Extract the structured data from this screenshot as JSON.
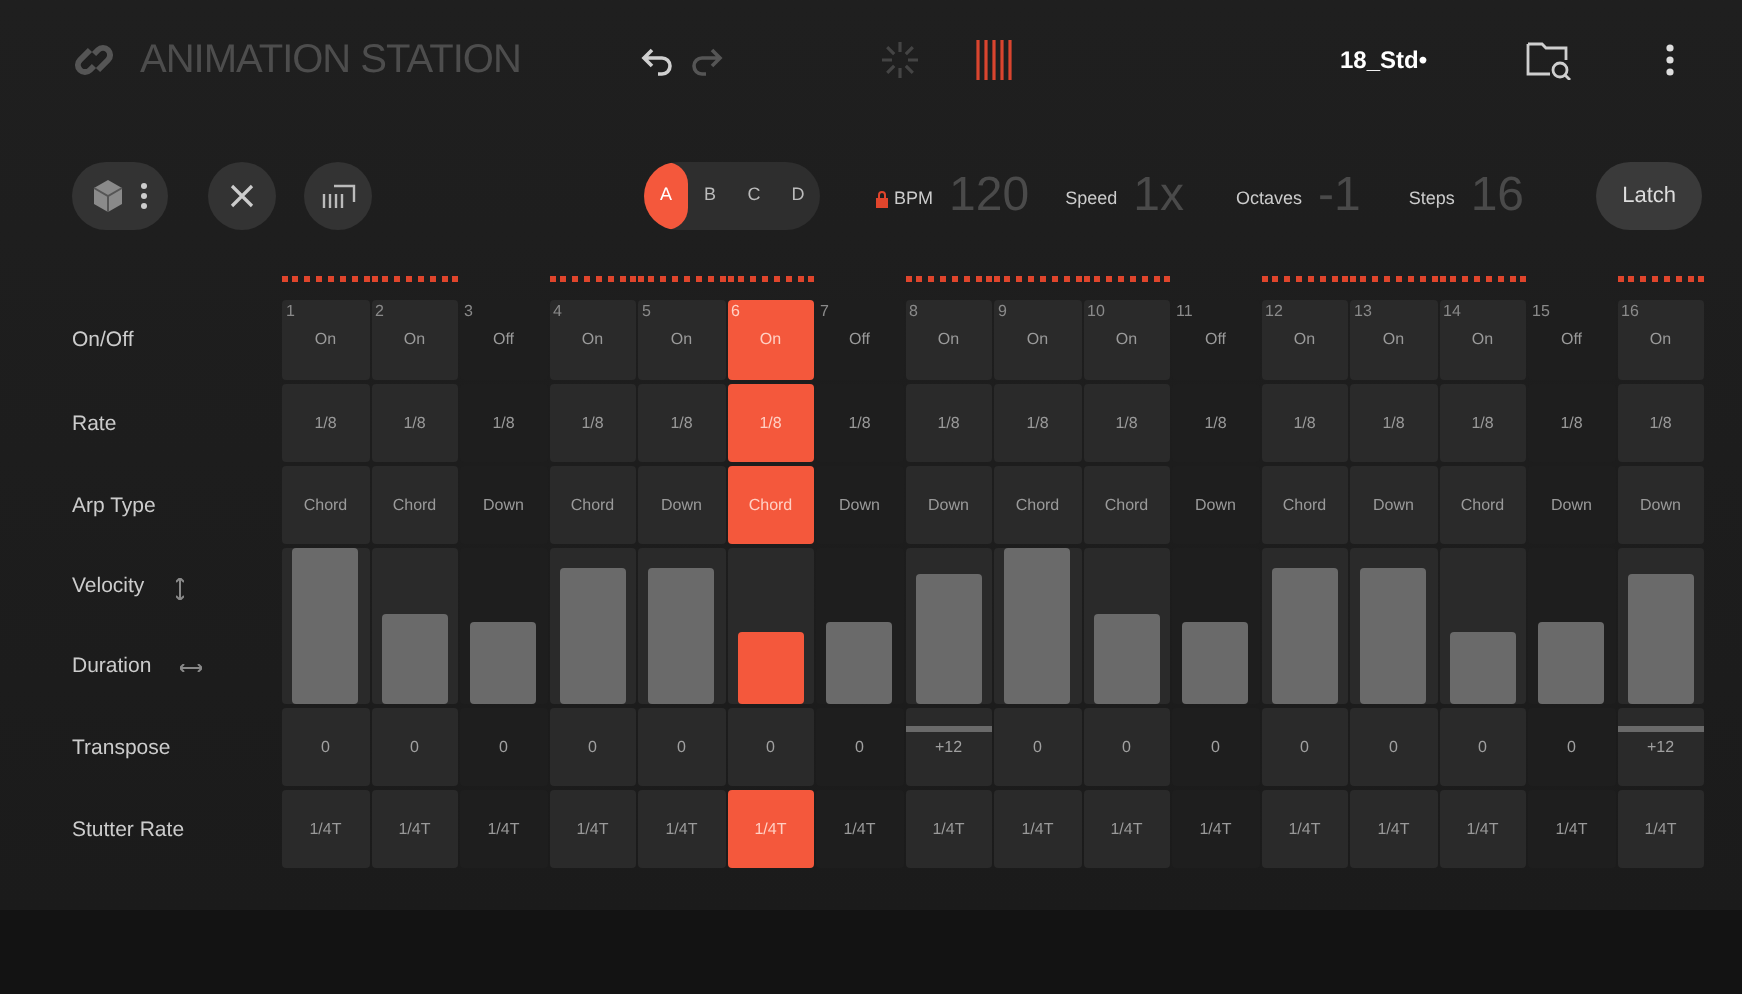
{
  "header": {
    "app_title": "ANIMATION STATION",
    "preset": "18_Std•"
  },
  "toolbar": {
    "patterns": [
      {
        "label": "A",
        "selected": true
      },
      {
        "label": "B",
        "selected": false
      },
      {
        "label": "C",
        "selected": false
      },
      {
        "label": "D",
        "selected": false
      }
    ],
    "params": [
      {
        "label": "BPM",
        "value": "120",
        "locked": true
      },
      {
        "label": "Speed",
        "value": "1x",
        "locked": false
      },
      {
        "label": "Octaves",
        "value": "-1",
        "locked": false
      },
      {
        "label": "Steps",
        "value": "16",
        "locked": false
      }
    ],
    "latch": "Latch"
  },
  "row_labels": [
    "On/Off",
    "Rate",
    "Arp Type",
    "Velocity",
    "Duration",
    "Transpose",
    "Stutter Rate"
  ],
  "steps": [
    {
      "number": "1",
      "on": true,
      "selected": false,
      "state": "On",
      "rate": "1/8",
      "arp": "Chord",
      "level": 1.0,
      "transpose": "0",
      "transpose_bar": false,
      "stutter": "1/4T"
    },
    {
      "number": "2",
      "on": true,
      "selected": false,
      "state": "On",
      "rate": "1/8",
      "arp": "Chord",
      "level": 0.58,
      "transpose": "0",
      "transpose_bar": false,
      "stutter": "1/4T"
    },
    {
      "number": "3",
      "on": false,
      "selected": false,
      "state": "Off",
      "rate": "1/8",
      "arp": "Down",
      "level": 0.53,
      "transpose": "0",
      "transpose_bar": false,
      "stutter": "1/4T"
    },
    {
      "number": "4",
      "on": true,
      "selected": false,
      "state": "On",
      "rate": "1/8",
      "arp": "Chord",
      "level": 0.87,
      "transpose": "0",
      "transpose_bar": false,
      "stutter": "1/4T"
    },
    {
      "number": "5",
      "on": true,
      "selected": false,
      "state": "On",
      "rate": "1/8",
      "arp": "Down",
      "level": 0.87,
      "transpose": "0",
      "transpose_bar": false,
      "stutter": "1/4T"
    },
    {
      "number": "6",
      "on": true,
      "selected": true,
      "state": "On",
      "rate": "1/8",
      "arp": "Chord",
      "level": 0.46,
      "transpose": "0",
      "transpose_bar": false,
      "stutter": "1/4T"
    },
    {
      "number": "7",
      "on": false,
      "selected": false,
      "state": "Off",
      "rate": "1/8",
      "arp": "Down",
      "level": 0.53,
      "transpose": "0",
      "transpose_bar": false,
      "stutter": "1/4T"
    },
    {
      "number": "8",
      "on": true,
      "selected": false,
      "state": "On",
      "rate": "1/8",
      "arp": "Down",
      "level": 0.83,
      "transpose": "+12",
      "transpose_bar": true,
      "stutter": "1/4T"
    },
    {
      "number": "9",
      "on": true,
      "selected": false,
      "state": "On",
      "rate": "1/8",
      "arp": "Chord",
      "level": 1.0,
      "transpose": "0",
      "transpose_bar": false,
      "stutter": "1/4T"
    },
    {
      "number": "10",
      "on": true,
      "selected": false,
      "state": "On",
      "rate": "1/8",
      "arp": "Chord",
      "level": 0.58,
      "transpose": "0",
      "transpose_bar": false,
      "stutter": "1/4T"
    },
    {
      "number": "11",
      "on": false,
      "selected": false,
      "state": "Off",
      "rate": "1/8",
      "arp": "Down",
      "level": 0.53,
      "transpose": "0",
      "transpose_bar": false,
      "stutter": "1/4T"
    },
    {
      "number": "12",
      "on": true,
      "selected": false,
      "state": "On",
      "rate": "1/8",
      "arp": "Chord",
      "level": 0.87,
      "transpose": "0",
      "transpose_bar": false,
      "stutter": "1/4T"
    },
    {
      "number": "13",
      "on": true,
      "selected": false,
      "state": "On",
      "rate": "1/8",
      "arp": "Down",
      "level": 0.87,
      "transpose": "0",
      "transpose_bar": false,
      "stutter": "1/4T"
    },
    {
      "number": "14",
      "on": true,
      "selected": false,
      "state": "On",
      "rate": "1/8",
      "arp": "Chord",
      "level": 0.46,
      "transpose": "0",
      "transpose_bar": false,
      "stutter": "1/4T"
    },
    {
      "number": "15",
      "on": false,
      "selected": false,
      "state": "Off",
      "rate": "1/8",
      "arp": "Down",
      "level": 0.53,
      "transpose": "0",
      "transpose_bar": false,
      "stutter": "1/4T"
    },
    {
      "number": "16",
      "on": true,
      "selected": false,
      "state": "On",
      "rate": "1/8",
      "arp": "Down",
      "level": 0.83,
      "transpose": "+12",
      "transpose_bar": true,
      "stutter": "1/4T"
    }
  ]
}
